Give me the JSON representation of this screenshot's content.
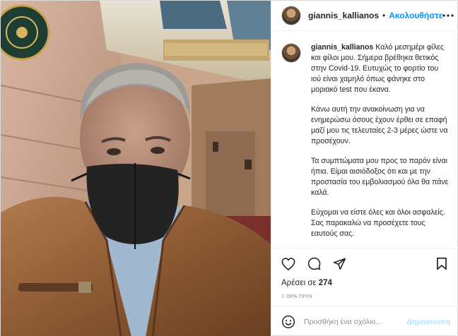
{
  "header": {
    "username": "giannis_kallianos",
    "separator": "•",
    "follow_label": "Ακολουθήστε"
  },
  "caption": {
    "username": "giannis_kallianos",
    "paragraphs": [
      "Καλό μεσημέρι φίλες και φίλοι μου. Σήμερα βρέθηκα θετικός στην Covid-19. Ευτυχώς το φορτίο του ιού είναι χαμηλό όπως φάνηκε στο μοριακό test που έκανα.",
      "Κάνω αυτή την ανακοίνωση για να ενημερώσω όσους έχουν έρθει σε επαφή μαζί μου τις τελευταίες 2-3 μέρες ώστε να προσέχουν.",
      "Τα συμπτώματα μου προς το παρόν είναι ήπια. Είμαι αισιόδοξος ότι και με την προστασία του εμβολιασμού όλα θα πάνε καλά.",
      "Εύχομαι να είστε όλες και όλοι ασφαλείς. Σας παρακαλώ να προσέχετε τους εαυτούς σας."
    ]
  },
  "likes": {
    "prefix": "Αρέσει σε",
    "count": "274"
  },
  "timestamp": "1 ΩΡΑ ΠΡΙΝ",
  "comment": {
    "placeholder": "Προσθήκη ένα σχόλιο...",
    "publish_label": "Δημοσίευση"
  },
  "icons": {
    "more": "more-horizontal-icon",
    "like": "heart-icon",
    "comment": "comment-bubble-icon",
    "share": "paper-plane-icon",
    "save": "bookmark-icon",
    "emoji": "smiley-icon"
  },
  "colors": {
    "accent": "#0095f6",
    "publish_disabled": "#b2dffc",
    "muted": "#8e8e8e",
    "text": "#262626"
  }
}
